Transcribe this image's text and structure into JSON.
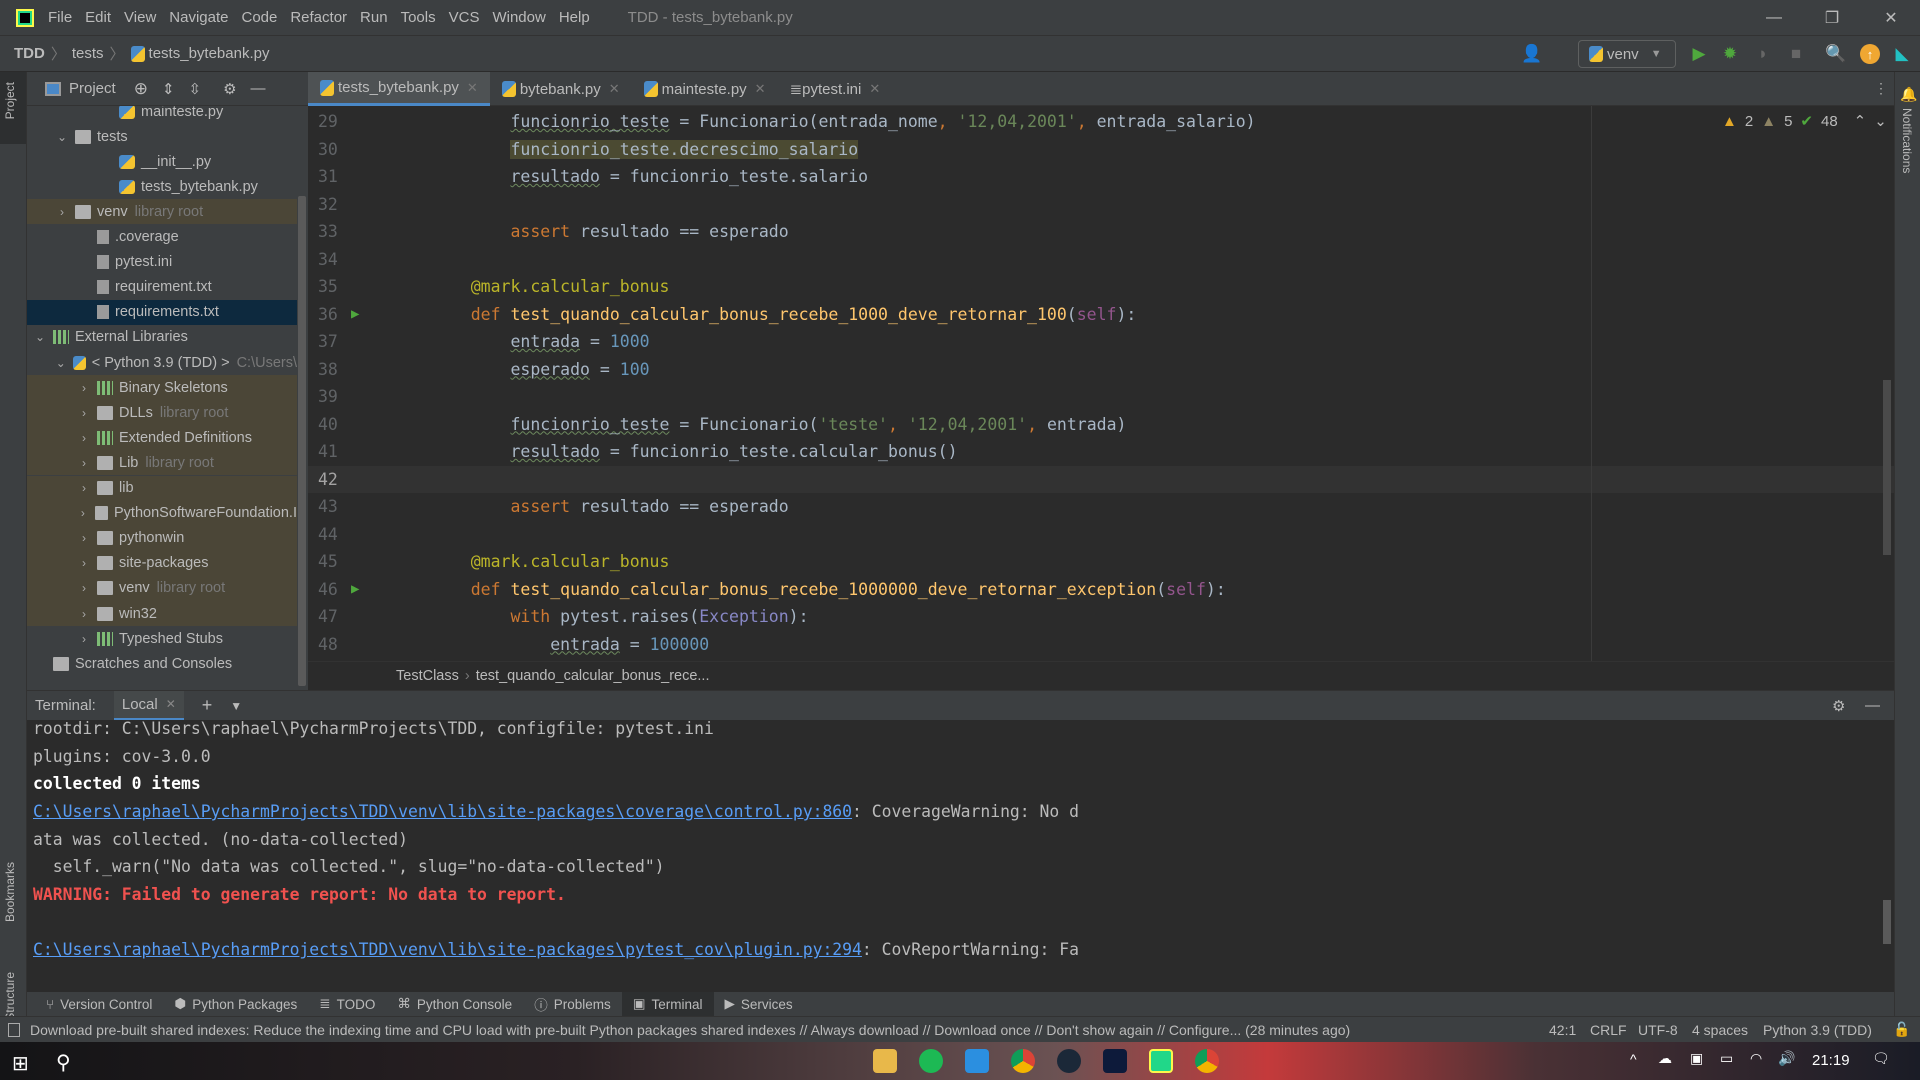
{
  "window": {
    "title": "TDD - tests_bytebank.py",
    "menu": [
      "File",
      "Edit",
      "View",
      "Navigate",
      "Code",
      "Refactor",
      "Run",
      "Tools",
      "VCS",
      "Window",
      "Help"
    ]
  },
  "navbar": {
    "crumbs": [
      "TDD",
      "tests",
      "tests_bytebank.py"
    ],
    "run_config": "venv"
  },
  "project": {
    "label": "Project",
    "rows": [
      {
        "name": "mainteste.py",
        "indent": 3,
        "icon": "python-file"
      },
      {
        "name": "tests",
        "indent": 1,
        "icon": "folder",
        "expanded": true
      },
      {
        "name": "__init__.py",
        "indent": 3,
        "icon": "python-file"
      },
      {
        "name": "tests_bytebank.py",
        "indent": 3,
        "icon": "python-file"
      },
      {
        "name": "venv",
        "suffix": "library root",
        "indent": 1,
        "icon": "folder",
        "collapsed": true,
        "lib": true
      },
      {
        "name": ".coverage",
        "indent": 2,
        "icon": "unknown-file"
      },
      {
        "name": "pytest.ini",
        "indent": 2,
        "icon": "ini-file"
      },
      {
        "name": "requirement.txt",
        "indent": 2,
        "icon": "text-file"
      },
      {
        "name": "requirements.txt",
        "indent": 2,
        "icon": "text-file",
        "selected": true
      },
      {
        "name": "External Libraries",
        "indent": 0,
        "icon": "library",
        "expanded": true
      },
      {
        "name": "< Python 3.9 (TDD) >",
        "suffix": "C:\\Users\\",
        "indent": 1,
        "icon": "python",
        "expanded": true
      },
      {
        "name": "Binary Skeletons",
        "indent": 2,
        "icon": "library",
        "collapsed": true,
        "lib": true
      },
      {
        "name": "DLLs",
        "suffix": "library root",
        "indent": 2,
        "icon": "folder",
        "collapsed": true,
        "lib": true
      },
      {
        "name": "Extended Definitions",
        "indent": 2,
        "icon": "library",
        "collapsed": true,
        "lib": true
      },
      {
        "name": "Lib",
        "suffix": "library root",
        "indent": 2,
        "icon": "folder",
        "collapsed": true,
        "lib": true
      },
      {
        "name": "lib",
        "indent": 2,
        "icon": "folder",
        "collapsed": true,
        "lib": true
      },
      {
        "name": "PythonSoftwareFoundation.I",
        "indent": 2,
        "icon": "folder",
        "collapsed": true,
        "lib": true
      },
      {
        "name": "pythonwin",
        "indent": 2,
        "icon": "folder",
        "collapsed": true,
        "lib": true
      },
      {
        "name": "site-packages",
        "indent": 2,
        "icon": "folder",
        "collapsed": true,
        "lib": true
      },
      {
        "name": "venv",
        "suffix": "library root",
        "indent": 2,
        "icon": "folder",
        "collapsed": true,
        "lib": true
      },
      {
        "name": "win32",
        "indent": 2,
        "icon": "folder",
        "collapsed": true,
        "lib": true
      },
      {
        "name": "Typeshed Stubs",
        "indent": 2,
        "icon": "library",
        "collapsed": true
      },
      {
        "name": "Scratches and Consoles",
        "indent": 0,
        "icon": "scratches"
      }
    ]
  },
  "tabs": [
    {
      "label": "tests_bytebank.py",
      "active": true
    },
    {
      "label": "bytebank.py"
    },
    {
      "label": "mainteste.py"
    },
    {
      "label": "pytest.ini"
    }
  ],
  "inspections": {
    "warnings": "2",
    "weak_warnings": "5",
    "typos": "48"
  },
  "editor": {
    "current_line": 42,
    "lines": [
      {
        "n": "29",
        "t": [
          [
            "p",
            "        "
          ],
          [
            "ul",
            "funcionrio_teste"
          ],
          [
            "p",
            " = Funcionario(entrada_nome"
          ],
          [
            "k",
            ", "
          ],
          [
            "s",
            "'12,04,2001'"
          ],
          [
            "k",
            ", "
          ],
          [
            "p",
            "entrada_salario)"
          ]
        ]
      },
      {
        "n": "30",
        "t": [
          [
            "p",
            "        "
          ],
          [
            "hl",
            "funcionrio_teste.decrescimo_salario"
          ]
        ]
      },
      {
        "n": "31",
        "t": [
          [
            "p",
            "        "
          ],
          [
            "ul",
            "resultado"
          ],
          [
            "p",
            " = funcionrio_teste.salario"
          ]
        ]
      },
      {
        "n": "32",
        "t": []
      },
      {
        "n": "33",
        "t": [
          [
            "p",
            "        "
          ],
          [
            "k",
            "assert"
          ],
          [
            "p",
            " resultado == esperado"
          ]
        ]
      },
      {
        "n": "34",
        "t": []
      },
      {
        "n": "35",
        "t": [
          [
            "p",
            "    "
          ],
          [
            "d",
            "@mark.calcular_bonus"
          ]
        ]
      },
      {
        "n": "36",
        "run": true,
        "t": [
          [
            "p",
            "    "
          ],
          [
            "k",
            "def "
          ],
          [
            "f",
            "test_quando_calcular_bonus_recebe_1000_deve_retornar_100"
          ],
          [
            "p",
            "("
          ],
          [
            "self",
            "self"
          ],
          [
            "p",
            "):"
          ]
        ]
      },
      {
        "n": "37",
        "t": [
          [
            "p",
            "        "
          ],
          [
            "ul",
            "entrada"
          ],
          [
            "p",
            " = "
          ],
          [
            "n",
            "1000"
          ]
        ]
      },
      {
        "n": "38",
        "t": [
          [
            "p",
            "        "
          ],
          [
            "ul",
            "esperado"
          ],
          [
            "p",
            " = "
          ],
          [
            "n",
            "100"
          ]
        ]
      },
      {
        "n": "39",
        "t": []
      },
      {
        "n": "40",
        "t": [
          [
            "p",
            "        "
          ],
          [
            "ul",
            "funcionrio_teste"
          ],
          [
            "p",
            " = Funcionario("
          ],
          [
            "s",
            "'teste'"
          ],
          [
            "k",
            ", "
          ],
          [
            "s",
            "'12,04,2001'"
          ],
          [
            "k",
            ", "
          ],
          [
            "p",
            "entrada)"
          ]
        ]
      },
      {
        "n": "41",
        "t": [
          [
            "p",
            "        "
          ],
          [
            "ul",
            "resultado"
          ],
          [
            "p",
            " = funcionrio_teste.calcular_bonus()"
          ]
        ]
      },
      {
        "n": "42",
        "t": []
      },
      {
        "n": "43",
        "t": [
          [
            "p",
            "        "
          ],
          [
            "k",
            "assert"
          ],
          [
            "p",
            " resultado == esperado"
          ]
        ]
      },
      {
        "n": "44",
        "t": []
      },
      {
        "n": "45",
        "t": [
          [
            "p",
            "    "
          ],
          [
            "d",
            "@mark.calcular_bonus"
          ]
        ]
      },
      {
        "n": "46",
        "run": true,
        "t": [
          [
            "p",
            "    "
          ],
          [
            "k",
            "def "
          ],
          [
            "f",
            "test_quando_calcular_bonus_recebe_1000000_deve_retornar_exception"
          ],
          [
            "p",
            "("
          ],
          [
            "self",
            "self"
          ],
          [
            "p",
            "):"
          ]
        ]
      },
      {
        "n": "47",
        "t": [
          [
            "p",
            "        "
          ],
          [
            "k",
            "with "
          ],
          [
            "p",
            "pytest.raises("
          ],
          [
            "cls",
            "Exception"
          ],
          [
            "p",
            "):"
          ]
        ]
      },
      {
        "n": "48",
        "t": [
          [
            "p",
            "            "
          ],
          [
            "ul",
            "entrada"
          ],
          [
            "p",
            " = "
          ],
          [
            "n",
            "100000"
          ]
        ]
      }
    ],
    "breadcrumb": [
      "TestClass",
      "test_quando_calcular_bonus_rece..."
    ]
  },
  "terminal": {
    "label": "Terminal:",
    "tab": "Local",
    "lines": [
      {
        "text": "rootdir: C:\\Users\\raphael\\PycharmProjects\\TDD, configfile: pytest.ini"
      },
      {
        "text": "plugins: cov-3.0.0"
      },
      {
        "text": "collected 0 items",
        "style": "b"
      },
      {
        "link": "C:\\Users\\raphael\\PycharmProjects\\TDD\\venv\\lib\\site-packages\\coverage\\control.py:860",
        "text": ": CoverageWarning: No d"
      },
      {
        "text": "ata was collected. (no-data-collected)"
      },
      {
        "text": "  self._warn(\"No data was collected.\", slug=\"no-data-collected\")"
      },
      {
        "text": "WARNING: Failed to generate report: No data to report.",
        "style": "err"
      },
      {
        "text": ""
      },
      {
        "link": "C:\\Users\\raphael\\PycharmProjects\\TDD\\venv\\lib\\site-packages\\pytest_cov\\plugin.py:294",
        "text": ": CovReportWarning: Fa"
      }
    ]
  },
  "side": {
    "left_top": "Project",
    "left_bookmarks": "Bookmarks",
    "left_structure": "Structure",
    "right": "Notifications"
  },
  "toolwindows": [
    {
      "label": "Version Control"
    },
    {
      "label": "Python Packages"
    },
    {
      "label": "TODO"
    },
    {
      "label": "Python Console"
    },
    {
      "label": "Problems"
    },
    {
      "label": "Terminal",
      "active": true
    },
    {
      "label": "Services"
    }
  ],
  "status": {
    "message": "Download pre-built shared indexes: Reduce the indexing time and CPU load with pre-built Python packages shared indexes // Always download // Download once // Don't show again // Configure... (28 minutes ago)",
    "position": "42:1",
    "line_sep": "CRLF",
    "encoding": "UTF-8",
    "indent": "4 spaces",
    "interpreter": "Python 3.9 (TDD)"
  },
  "taskbar": {
    "clock": "21:19"
  },
  "colors": {
    "accent": "#4a88c7",
    "keyword": "#cc7832",
    "string": "#6a8759",
    "number": "#6897bb",
    "error": "#f0524f",
    "link": "#589df6"
  }
}
